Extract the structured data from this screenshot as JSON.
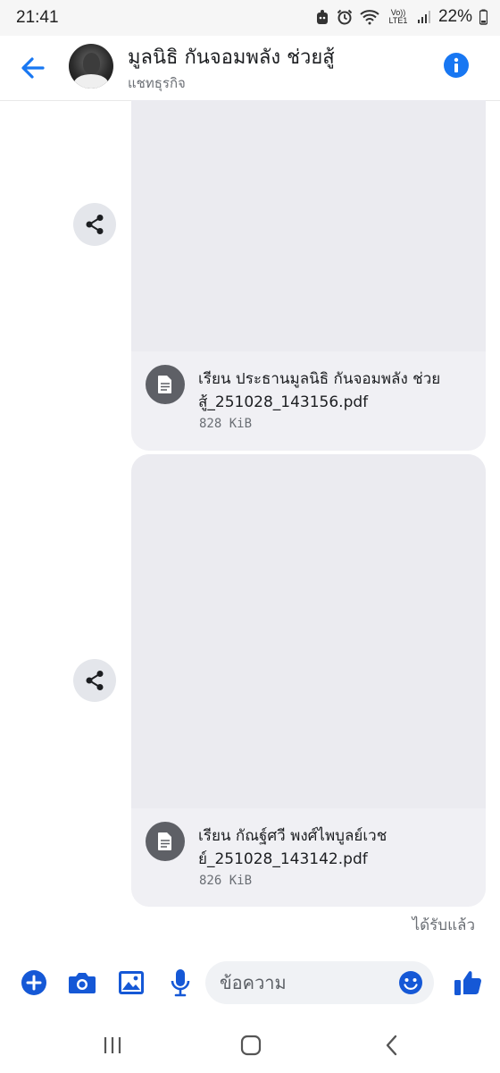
{
  "status_bar": {
    "time": "21:41",
    "network": "Vo)) LTE1",
    "battery": "22%"
  },
  "header": {
    "title": "มูลนิธิ กันจอมพลัง ช่วยสู้",
    "subtitle": "แชทธุรกิจ",
    "accent_color": "#1877f2"
  },
  "messages": [
    {
      "type": "file",
      "filename": "เรียน ประธานมูลนิธิ กันจอมพลัง ช่วยสู้_251028_143156.pdf",
      "size": "828 KiB",
      "icon": "document-icon"
    },
    {
      "type": "file",
      "filename": "เรียน กัณฐ์ศวี พงศ์ไพบูลย์เวช ย์_251028_143142.pdf",
      "size": "826 KiB",
      "icon": "document-icon"
    }
  ],
  "delivered_status": "ได้รับแล้ว",
  "composer": {
    "placeholder": "ข้อความ",
    "icons": [
      "plus-icon",
      "camera-icon",
      "image-icon",
      "microphone-icon",
      "emoji-icon",
      "thumbs-up-icon"
    ]
  },
  "navbar": {
    "icons": [
      "recent-apps-icon",
      "home-icon",
      "back-icon"
    ]
  }
}
